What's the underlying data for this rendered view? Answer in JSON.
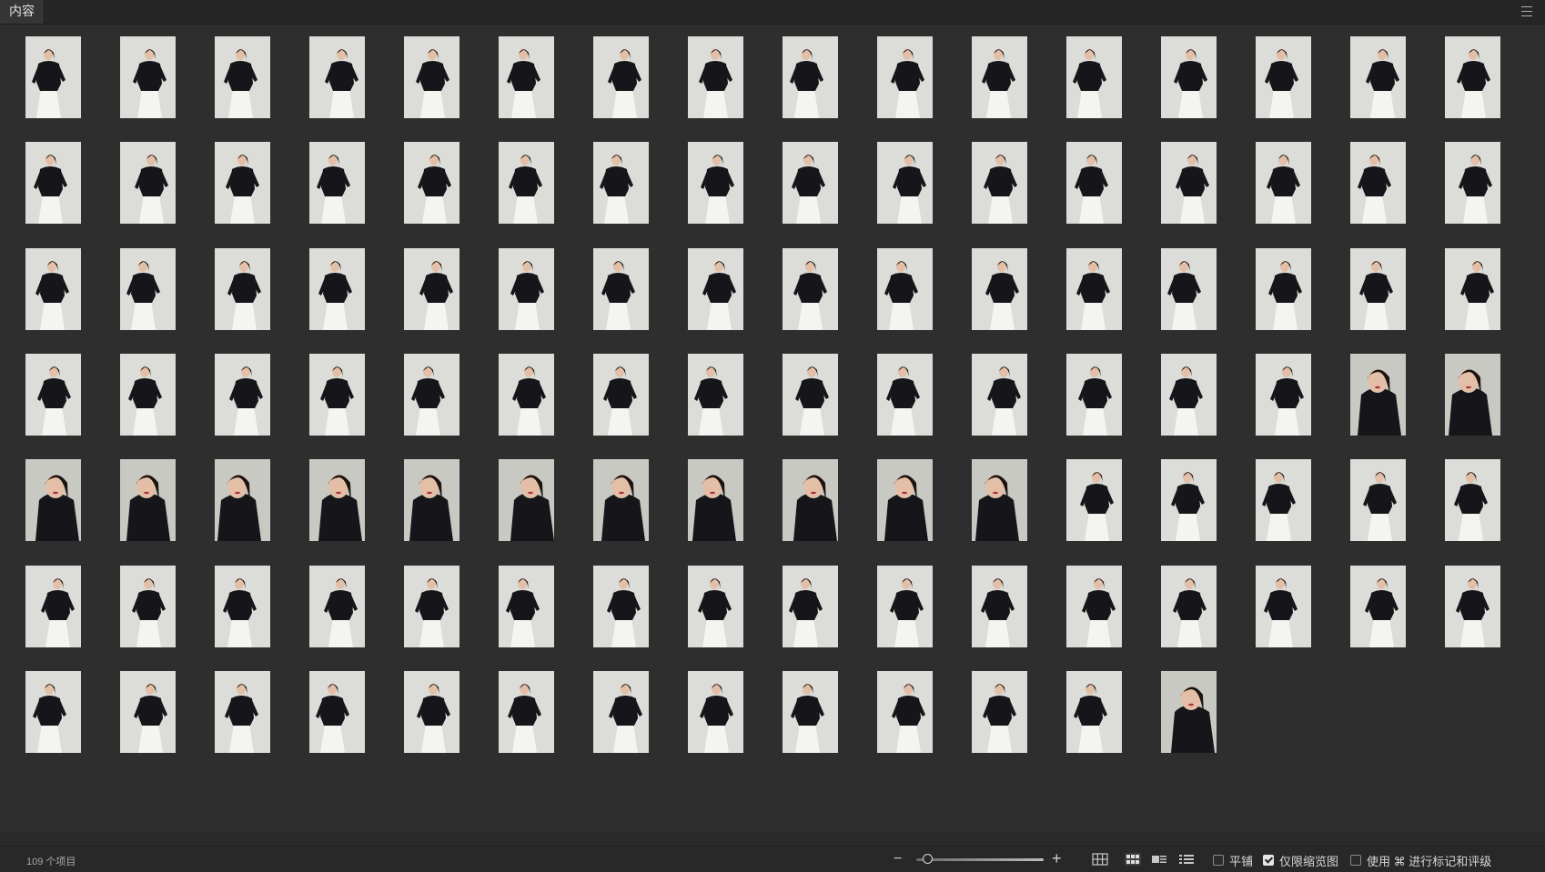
{
  "panel": {
    "tab_label": "内容",
    "menu_icon": "hamburger-menu-icon"
  },
  "thumbnails": {
    "columns": 16,
    "total_shown": 109,
    "subject": "portrait photos of a woman in black top and white skirt on light gray backdrop",
    "close_up_indices": [
      62,
      63,
      64,
      65,
      66,
      67,
      68,
      69,
      70,
      71,
      72,
      73,
      74,
      108
    ]
  },
  "status": {
    "item_count": "109 个项目"
  },
  "zoom": {
    "minus_label": "−",
    "plus_label": "+",
    "minus_icon": "zoom-out-icon",
    "plus_icon": "zoom-in-icon",
    "level": 0.05
  },
  "view_modes": [
    {
      "name": "grid-large-view",
      "active": false
    },
    {
      "name": "grid-small-view",
      "active": true
    },
    {
      "name": "detail-view",
      "active": false
    },
    {
      "name": "list-view",
      "active": false
    }
  ],
  "options": {
    "tile_label": "平铺",
    "tile_checked": false,
    "thumb_only_label": "仅限缩览图",
    "thumb_only_checked": true,
    "use_label": "使用 ⌘ 进行标记和评级",
    "use_checked": false
  }
}
